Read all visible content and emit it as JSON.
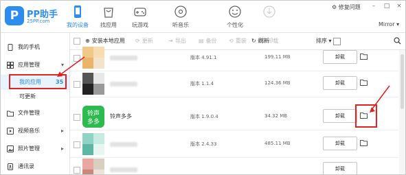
{
  "app": {
    "brand": "PP助手",
    "brand_sub": "25PP.com",
    "feedback": "修复问题",
    "device_name": "Mirror",
    "window_controls": [
      "–",
      "□",
      "×"
    ]
  },
  "nav": [
    {
      "label": "我的设备",
      "icon": "phone-icon",
      "active": true
    },
    {
      "label": "找应用",
      "icon": "shopping-bag-icon",
      "active": false
    },
    {
      "label": "玩游戏",
      "icon": "gamepad-icon",
      "active": false
    },
    {
      "label": "听音乐",
      "icon": "music-disc-icon",
      "active": false
    },
    {
      "label": "个性化",
      "icon": "smiley-icon",
      "active": false
    },
    {
      "label": "",
      "icon": "download-icon",
      "active": false
    }
  ],
  "sidebar": {
    "items": [
      {
        "label": "我的手机",
        "icon": "phone-outline-icon",
        "chevron": ""
      },
      {
        "label": "应用管理",
        "icon": "apps-grid-icon",
        "chevron": "▾"
      },
      {
        "label": "文件管理",
        "icon": "folder-icon",
        "chevron": ""
      },
      {
        "label": "视频音乐",
        "icon": "play-icon",
        "chevron": "▸"
      },
      {
        "label": "照片管理",
        "icon": "image-icon",
        "chevron": "▸"
      },
      {
        "label": "通讯录",
        "icon": "contacts-icon",
        "chevron": ""
      }
    ],
    "sub_items": [
      {
        "label": "我的应用",
        "count": "35",
        "active": true
      },
      {
        "label": "可更新",
        "count": "",
        "active": false
      }
    ]
  },
  "toolbar": {
    "install_local": "安装本地应用",
    "update": "更新",
    "export": "导出",
    "backup": "备份",
    "reinstall": "重装",
    "uninstall": "卸载",
    "refresh": "刷新",
    "sort": "排序"
  },
  "apps": [
    {
      "name": "",
      "version": "版本 4.91.1",
      "size": "199.11 MB",
      "action": "卸载",
      "thumb_colors": [
        "#f0c98a",
        "#f7dcb1",
        "#e9b56a",
        "#f3e3cb"
      ]
    },
    {
      "name": "",
      "version": "版本 1.1.4",
      "size": "124.36 MB",
      "action": "卸载",
      "thumb_colors": [
        "#555555",
        "#e8e8e8",
        "#222222",
        "#9a9a9a"
      ]
    },
    {
      "name": "铃声多多",
      "version": "版本 1.9.0.4",
      "size": "34.32 MB",
      "action": "卸载",
      "thumb_colors": [
        "#2bbb4e"
      ]
    },
    {
      "name": "",
      "version": "版本 2.4.33",
      "size": "485.11 MB",
      "action": "卸载",
      "thumb_colors": [
        "#8fd3c4",
        "#c6ebe1",
        "#5eb7a5",
        "#e8f6f2"
      ]
    },
    {
      "name": "",
      "version": "",
      "size": "",
      "action": "卸载",
      "thumb_colors": [
        "#e9a7a0",
        "#d9cfc0",
        "#c8897f",
        "#efe2d6"
      ]
    }
  ],
  "icon_labels": {
    "ringtone_line1": "铃声",
    "ringtone_line2": "多多"
  },
  "colors": {
    "accent": "#2d8cf0",
    "annotation": "#e22222",
    "ringtone_green": "#2bbb4e"
  }
}
